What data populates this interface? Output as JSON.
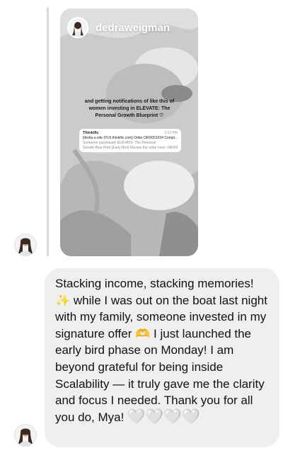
{
  "story": {
    "username": "dedraweigman",
    "caption_line1": "and getting notifications of like this of",
    "caption_line2": "women investing in ELEVATE: The",
    "caption_line3": "Personal Growth Blueprint ♡",
    "notification": {
      "app": "Thinkific",
      "time": "3:22 PM",
      "line1": "[dedra-s-site-37c5.thinkific.com] Order ORD001024 Compl...",
      "line2": "Someone purchased: ELEVATE: The Personal",
      "line3": "Growth Blue Print (Early Bird) Review the order here: ORD00..."
    }
  },
  "message": {
    "part1": "Stacking income, stacking memories!",
    "sparkle_emoji": "✨",
    "part2": "while I was out on the boat last night with my family, someone invested in my signature offer",
    "hands_emoji": "🫶",
    "part3": "I just launched the early bird phase on Monday! I am beyond grateful for being inside Scalability — it truly gave me the clarity and focus I needed. Thank you for all you do, Mya!",
    "hearts": "🤍🤍🤍🤍"
  },
  "colors": {
    "bubble": "#efefef",
    "reply_line": "#dadada"
  },
  "icons": {
    "sender_avatar": "profile-photo",
    "story_avatar": "profile-photo"
  }
}
